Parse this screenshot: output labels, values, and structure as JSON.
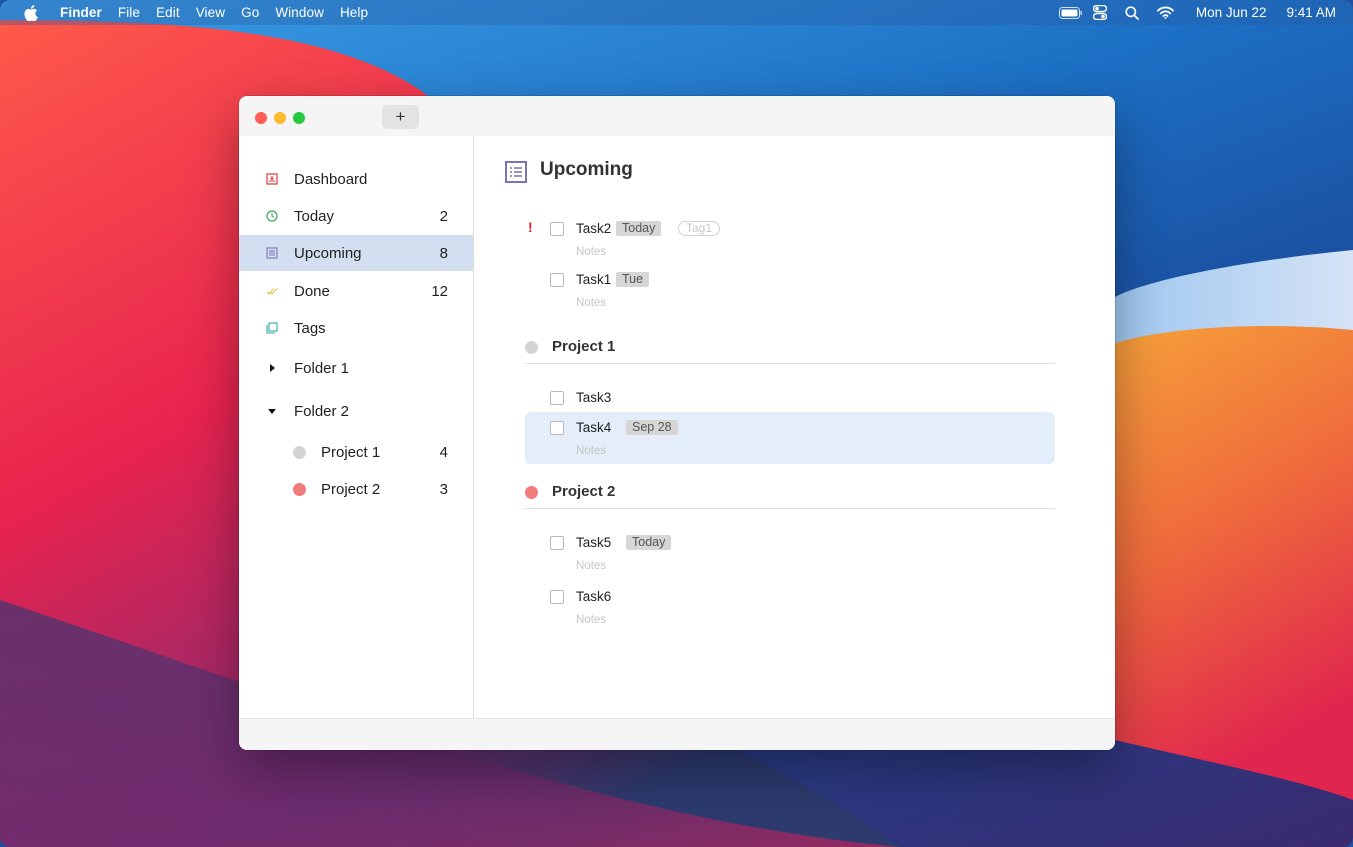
{
  "menubar": {
    "app_name": "Finder",
    "menus": [
      "File",
      "Edit",
      "View",
      "Go",
      "Window",
      "Help"
    ],
    "date": "Mon Jun 22",
    "time": "9:41 AM",
    "icons": [
      "apple-logo",
      "battery-icon",
      "control-center-icon",
      "search-icon",
      "wifi-icon"
    ]
  },
  "window": {
    "add_label": "+",
    "sidebar": {
      "items": [
        {
          "label": "Dashboard",
          "count": "",
          "icon": "dashboard-icon",
          "color": "#e0393e"
        },
        {
          "label": "Today",
          "count": "2",
          "icon": "clock-icon",
          "color": "#3aa85a"
        },
        {
          "label": "Upcoming",
          "count": "8",
          "icon": "list-icon",
          "color": "#7a73b8"
        },
        {
          "label": "Done",
          "count": "12",
          "icon": "double-check-icon",
          "color": "#d8c33a"
        },
        {
          "label": "Tags",
          "count": "",
          "icon": "tag-icon",
          "color": "#2fa8a8"
        }
      ],
      "folders": [
        {
          "label": "Folder 1",
          "expanded": false
        },
        {
          "label": "Folder 2",
          "expanded": true
        }
      ],
      "projects": [
        {
          "label": "Project 1",
          "count": "4",
          "color": "#d4d4d4"
        },
        {
          "label": "Project 2",
          "count": "3",
          "color": "#f07c7c"
        }
      ]
    },
    "main": {
      "title": "Upcoming",
      "tasks": [
        {
          "title": "Task2",
          "date": "Today",
          "tag": "Tag1",
          "notes": "Notes",
          "priority": "!"
        },
        {
          "title": "Task1",
          "date": "Tue",
          "notes": "Notes"
        }
      ],
      "projects": [
        {
          "name": "Project 1",
          "color": "#d4d4d4",
          "tasks": [
            {
              "title": "Task3"
            },
            {
              "title": "Task4",
              "date": "Sep 28",
              "notes": "Notes"
            }
          ]
        },
        {
          "name": "Project 2",
          "color": "#f07c7c",
          "tasks": [
            {
              "title": "Task5",
              "date": "Today",
              "notes": "Notes"
            },
            {
              "title": "Task6",
              "notes": "Notes"
            }
          ]
        }
      ]
    }
  }
}
